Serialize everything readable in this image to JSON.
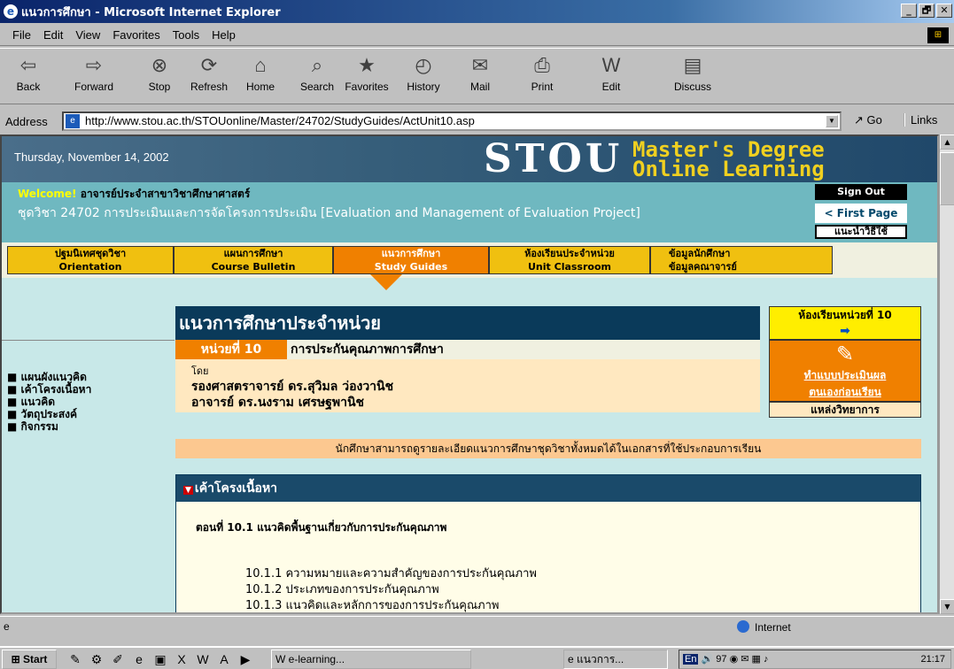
{
  "window": {
    "title": "แนวการศึกษา - Microsoft Internet Explorer",
    "buttons": [
      "_",
      "🗗",
      "✕"
    ]
  },
  "menu": [
    "File",
    "Edit",
    "View",
    "Favorites",
    "Tools",
    "Help"
  ],
  "toolbar": {
    "back": "Back",
    "forward": "Forward",
    "stop": "Stop",
    "refresh": "Refresh",
    "home": "Home",
    "search": "Search",
    "favorites": "Favorites",
    "history": "History",
    "mail": "Mail",
    "print": "Print",
    "edit": "Edit",
    "discuss": "Discuss"
  },
  "address": {
    "label": "Address",
    "url": "http://www.stou.ac.th/STOUonline/Master/24702/StudyGuides/ActUnit10.asp",
    "go": "Go",
    "links": "Links"
  },
  "page": {
    "date": "Thursday, November 14, 2002",
    "logo": "STOU",
    "master1": "Master's Degree",
    "master2": "Online Learning",
    "welcome_word": "Welcome!",
    "welcome_user": "อาจารย์ประจำสาขาวิชาศึกษาศาสตร์",
    "course": "ชุดวิชา 24702 การประเมินและการจัดโครงการประเมิน [Evaluation and Management of Evaluation Project]",
    "signout": "Sign Out",
    "firstpage": "< First Page",
    "guide": "แนะนำวิธีใช้",
    "nav": [
      {
        "th": "ปฐมนิเทศชุดวิชา",
        "en": "Orientation"
      },
      {
        "th": "แผนการศึกษา",
        "en": "Course Bulletin"
      },
      {
        "th": "แนวการศึกษา",
        "en": "Study Guides"
      },
      {
        "th": "ห้องเรียนประจำหน่วย",
        "en": "Unit Classroom"
      },
      {
        "th": "ข้อมูลนักศึกษา",
        "en": "ข้อมูลคณาจารย์"
      }
    ],
    "section_title": "แนวการศึกษาประจำหน่วย",
    "unit_no": "หน่วยที่ 10",
    "unit_name": "การประกันคุณภาพการศึกษา",
    "by": "โดย",
    "authors": [
      "รองศาสตราจารย์ ดร.สุวิมล ว่องวานิช",
      "อาจารย์ ดร.นงราม เศรษฐพานิช"
    ],
    "sidebar": [
      "แผนผังแนวคิด",
      "เค้าโครงเนื้อหา",
      "แนวคิด",
      "วัตถุประสงค์",
      "กิจกรรม"
    ],
    "right": {
      "classroom": "ห้องเรียนหน่วยที่ 10",
      "eval1": "ทำแบบประเมินผล",
      "eval2": "ตนเองก่อนเรียน",
      "resources": "แหล่งวิทยาการ"
    },
    "notice": "นักศึกษาสามารถดูรายละเอียดแนวการศึกษาชุดวิชาทั้งหมดได้ในเอกสารที่ใช้ประกอบการเรียน",
    "outline_head": "เค้าโครงเนื้อหา",
    "sec101": "ตอนที่ 10.1 แนวคิดพื้นฐานเกี่ยวกับการประกันคุณภาพ",
    "subs": [
      "10.1.1 ความหมายและความสำคัญของการประกันคุณภาพ",
      "10.1.2 ประเภทของการประกันคุณภาพ",
      "10.1.3 แนวคิดและหลักการของการประกันคุณภาพ"
    ]
  },
  "status": {
    "zone": "Internet"
  },
  "taskbar": {
    "start": "Start",
    "task1": "e-learning...",
    "task2": "แนวการ...",
    "clock": "21:17",
    "lang": "En",
    "tray_num": "97"
  }
}
